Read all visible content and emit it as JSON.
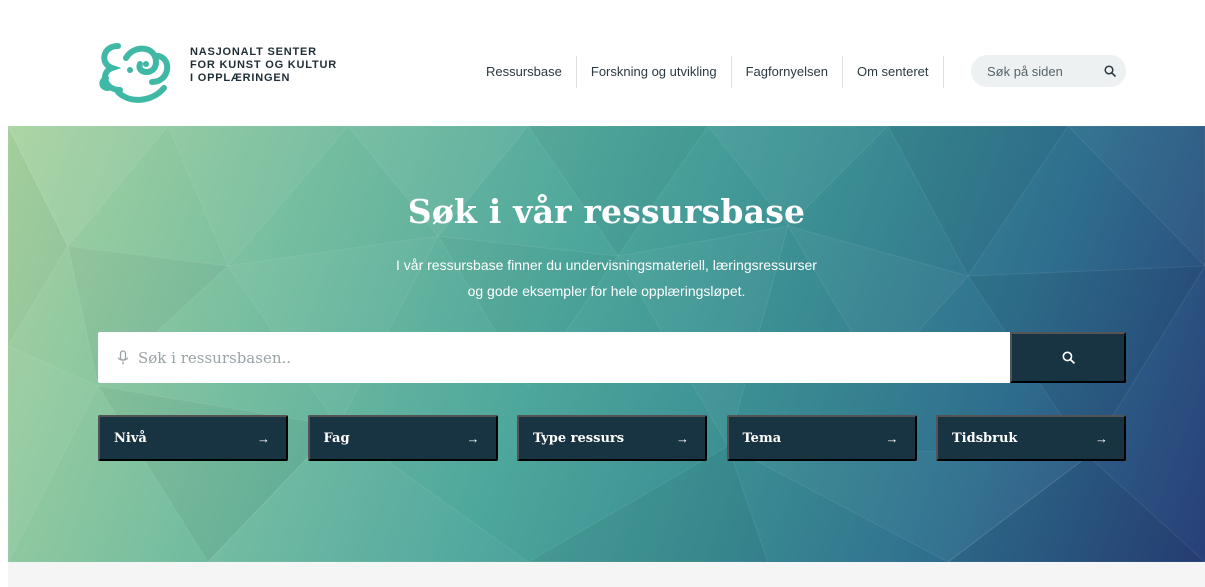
{
  "header": {
    "logo_lines": [
      "NASJONALT SENTER",
      "FOR KUNST OG KULTUR",
      "I OPPLÆRINGEN"
    ],
    "nav": [
      "Ressursbase",
      "Forskning og utvikling",
      "Fagfornyelsen",
      "Om senteret"
    ],
    "site_search_label": "Søk på siden"
  },
  "hero": {
    "title": "Søk i vår ressursbase",
    "description_lines": [
      "I vår ressursbase finner du undervisningsmateriell, læringsressurser",
      "og gode eksempler for hele opplæringsløpet."
    ],
    "search_placeholder": "Søk i ressursbasen..",
    "filters": [
      {
        "label": "Nivå",
        "arrow": "→"
      },
      {
        "label": "Fag",
        "arrow": "→"
      },
      {
        "label": "Type ressurs",
        "arrow": "→"
      },
      {
        "label": "Tema",
        "arrow": "→"
      },
      {
        "label": "Tidsbruk",
        "arrow": "→"
      }
    ]
  },
  "colors": {
    "brand_teal": "#3fb8a6",
    "dark_navy": "#183341",
    "header_bg": "#ffffff"
  },
  "icons": {
    "logo": "kks-face-logo",
    "site_search": "search-icon",
    "field_mic": "microphone-icon",
    "search_button": "search-icon",
    "filter_arrow": "arrow-right-icon"
  }
}
